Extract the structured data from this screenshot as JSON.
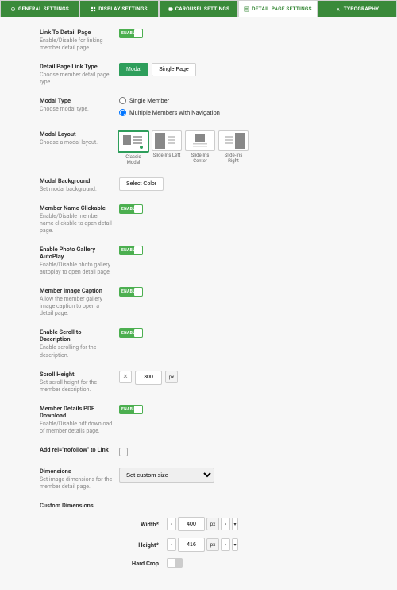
{
  "tabs": {
    "general": "GENERAL SETTINGS",
    "display": "DISPLAY SETTINGS",
    "carousel": "CAROUSEL SETTINGS",
    "detail": "DETAIL PAGE SETTINGS",
    "typography": "TYPOGRAPHY"
  },
  "settings": {
    "link_detail": {
      "label": "Link To Detail Page",
      "desc": "Enable/Disable for linking member detail page.",
      "value": "ENABLED"
    },
    "link_type": {
      "label": "Detail Page Link Type",
      "desc": "Choose member detail page type.",
      "modal": "Modal",
      "single": "Single Page"
    },
    "modal_type": {
      "label": "Modal Type",
      "desc": "Choose modal type.",
      "opt1": "Single Member",
      "opt2": "Multiple Members with Navigation"
    },
    "modal_layout": {
      "label": "Modal Layout",
      "desc": "Choose a modal layout.",
      "l1": "Classic Modal",
      "l2": "Slide-Ins Left",
      "l3": "Slide-Ins Center",
      "l4": "Slide-Ins Right"
    },
    "modal_bg": {
      "label": "Modal Background",
      "desc": "Set modal background.",
      "btn": "Select Color"
    },
    "name_click": {
      "label": "Member Name Clickable",
      "desc": "Enable/Disable member name clickable to open detail page.",
      "value": "ENABLED"
    },
    "autoplay": {
      "label": "Enable Photo Gallery AutoPlay",
      "desc": "Enable/Disable photo gallery autoplay to open detail page.",
      "value": "ENABLED"
    },
    "caption": {
      "label": "Member Image Caption",
      "desc": "Allow the member gallery image caption to open a detail page.",
      "value": "ENABLED"
    },
    "scroll_desc": {
      "label": "Enable Scroll to Description",
      "desc": "Enable scrolling for the description.",
      "value": "ENABLED"
    },
    "scroll_h": {
      "label": "Scroll Height",
      "desc": "Set scroll height for the member description.",
      "clear": "✕",
      "value": "300",
      "unit": "px"
    },
    "pdf": {
      "label": "Member Details PDF Download",
      "desc": "Enable/Disable pdf download of member details page.",
      "value": "ENABLED"
    },
    "nofollow": {
      "label": "Add rel=\"nofollow\" to Link"
    },
    "dimensions": {
      "label": "Dimensions",
      "desc": "Set image dimensions for the member detail page.",
      "selected": "Set custom size"
    }
  },
  "custom": {
    "head": "Custom Dimensions",
    "width": {
      "label": "Width*",
      "value": "400",
      "unit": "px"
    },
    "height": {
      "label": "Height*",
      "value": "416",
      "unit": "px"
    },
    "hardcrop": {
      "label": "Hard Crop"
    },
    "minus": "‹",
    "plus": "›",
    "chev": "▾"
  }
}
